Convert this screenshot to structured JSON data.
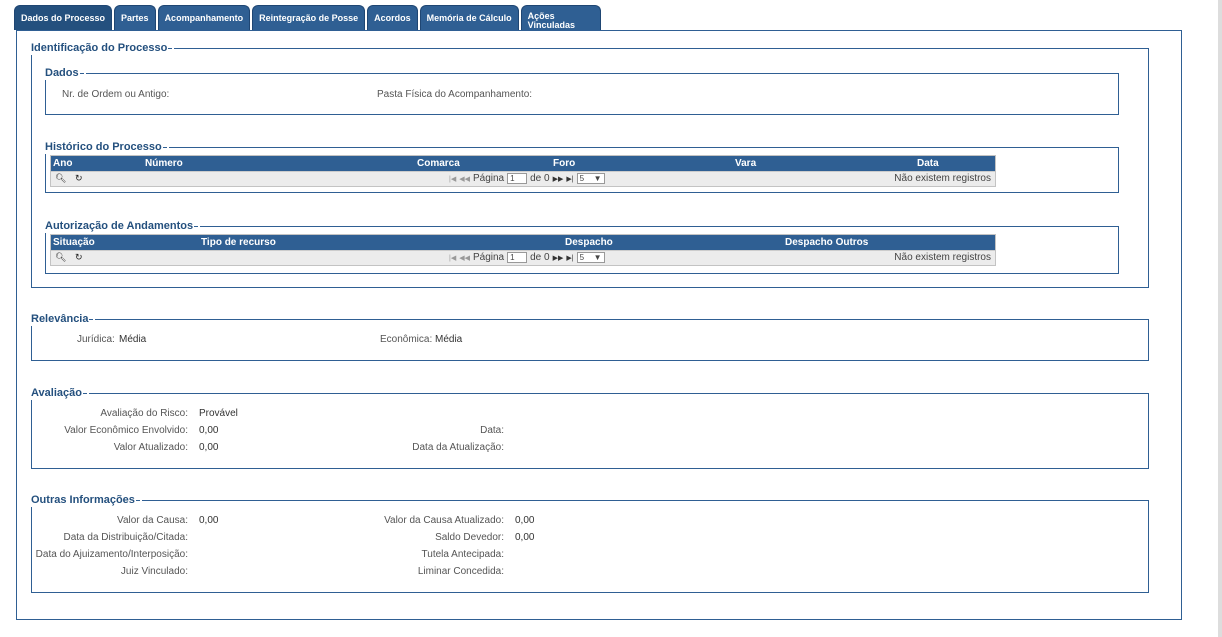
{
  "tabs": [
    "Dados do Processo",
    "Partes",
    "Acompanhamento",
    "Reintegração de Posse",
    "Acordos",
    "Memória de Cálculo",
    "Ações Vinculadas"
  ],
  "identificacao": {
    "legend": "Identificação do Processo",
    "dados": {
      "legend": "Dados",
      "nr_ordem_label": "Nr. de Ordem ou Antigo:",
      "nr_ordem_value": "",
      "pasta_label": "Pasta Física do Acompanhamento:",
      "pasta_value": ""
    },
    "historico": {
      "legend": "Histórico do Processo",
      "columns": [
        "Ano",
        "Número",
        "Comarca",
        "Foro",
        "Vara",
        "Data"
      ],
      "pager_label": "Página",
      "page": "1",
      "of_label": "de 0",
      "page_size": "5",
      "empty": "Não existem registros"
    },
    "autorizacao": {
      "legend": "Autorização de Andamentos",
      "columns": [
        "Situação",
        "Tipo de recurso",
        "Despacho",
        "Despacho Outros"
      ],
      "pager_label": "Página",
      "page": "1",
      "of_label": "de 0",
      "page_size": "5",
      "empty": "Não existem registros"
    }
  },
  "relevancia": {
    "legend": "Relevância",
    "juridica_label": "Jurídica:",
    "juridica_value": "Média",
    "economica_label": "Econômica:",
    "economica_value": "Média"
  },
  "avaliacao": {
    "legend": "Avaliação",
    "risco_label": "Avaliação do Risco:",
    "risco_value": "Provável",
    "valor_env_label": "Valor Econômico Envolvido:",
    "valor_env_value": "0,00",
    "data_label": "Data:",
    "data_value": "",
    "valor_atual_label": "Valor Atualizado:",
    "valor_atual_value": "0,00",
    "data_atual_label": "Data da Atualização:",
    "data_atual_value": ""
  },
  "outras": {
    "legend": "Outras Informações",
    "valor_causa_label": "Valor da Causa:",
    "valor_causa_value": "0,00",
    "valor_causa_atual_label": "Valor da Causa Atualizado:",
    "valor_causa_atual_value": "0,00",
    "data_dist_label": "Data da Distribuição/Citada:",
    "saldo_label": "Saldo Devedor:",
    "saldo_value": "0,00",
    "data_ajuiz_label": "Data do Ajuizamento/Interposição:",
    "tutela_label": "Tutela Antecipada:",
    "juiz_label": "Juiz Vinculado:",
    "liminar_label": "Liminar Concedida:"
  },
  "icons": {
    "search": "search-icon",
    "refresh": "refresh-icon"
  },
  "colors": {
    "primary": "#2f5f93",
    "tab_active": "#24507e"
  }
}
